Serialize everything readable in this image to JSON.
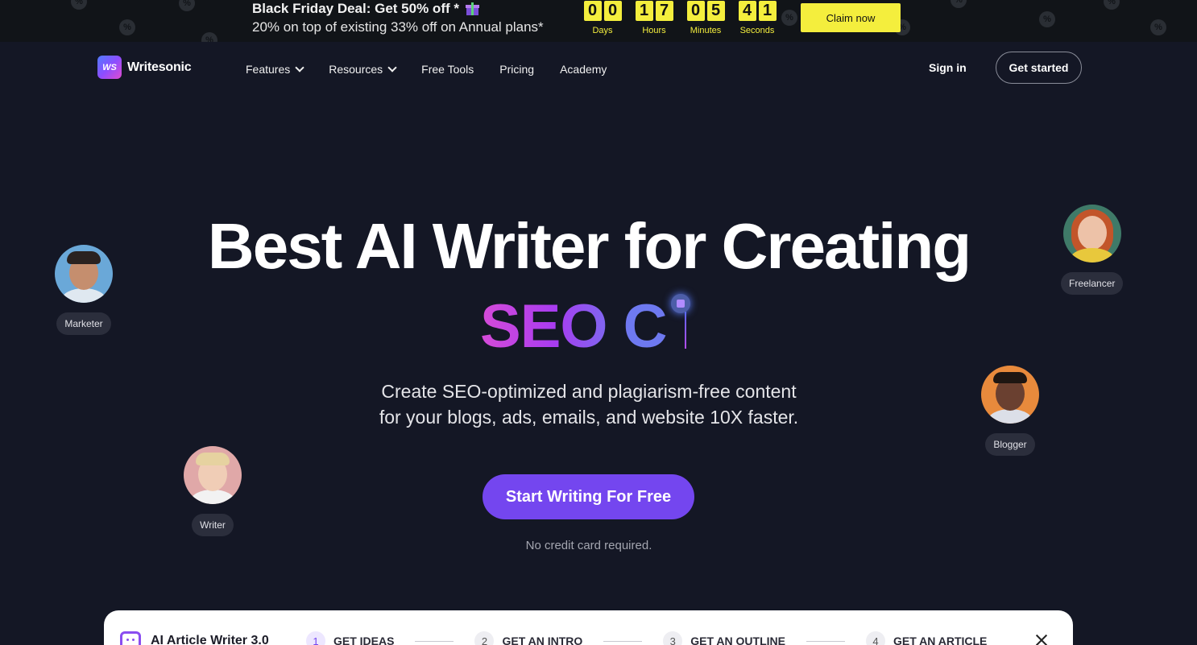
{
  "promo": {
    "title": "Black Friday Deal: Get 50% off *",
    "subtitle": "20% on top of existing 33% off on Annual plans*",
    "gift_icon": "gift-icon",
    "badge_glyph": "%",
    "countdown": [
      {
        "digits": [
          "0",
          "0"
        ],
        "label": "Days"
      },
      {
        "digits": [
          "1",
          "7"
        ],
        "label": "Hours"
      },
      {
        "digits": [
          "0",
          "5"
        ],
        "label": "Minutes"
      },
      {
        "digits": [
          "4",
          "1"
        ],
        "label": "Seconds"
      }
    ],
    "claim_label": "Claim now",
    "accent_color": "#f4ee3d"
  },
  "nav": {
    "logo_mark": "WS",
    "logo_text": "Writesonic",
    "items": [
      {
        "label": "Features",
        "has_dropdown": true
      },
      {
        "label": "Resources",
        "has_dropdown": true
      },
      {
        "label": "Free Tools",
        "has_dropdown": false
      },
      {
        "label": "Pricing",
        "has_dropdown": false
      },
      {
        "label": "Academy",
        "has_dropdown": false
      }
    ],
    "sign_in": "Sign in",
    "get_started": "Get started"
  },
  "hero": {
    "title": "Best AI Writer for Creating",
    "typed_text": "SEO C",
    "subtitle_line1": "Create SEO-optimized and plagiarism-free content",
    "subtitle_line2": "for your blogs, ads, emails, and website 10X faster.",
    "cta": "Start Writing For Free",
    "note": "No credit card required.",
    "cta_color": "#7446ef"
  },
  "personas": [
    {
      "label": "Marketer"
    },
    {
      "label": "Freelancer"
    },
    {
      "label": "Blogger"
    },
    {
      "label": "Writer"
    }
  ],
  "panel": {
    "title": "AI Article Writer 3.0",
    "steps": [
      {
        "num": "1",
        "label": "GET IDEAS"
      },
      {
        "num": "2",
        "label": "GET AN INTRO"
      },
      {
        "num": "3",
        "label": "GET AN OUTLINE"
      },
      {
        "num": "4",
        "label": "GET AN ARTICLE"
      }
    ]
  }
}
